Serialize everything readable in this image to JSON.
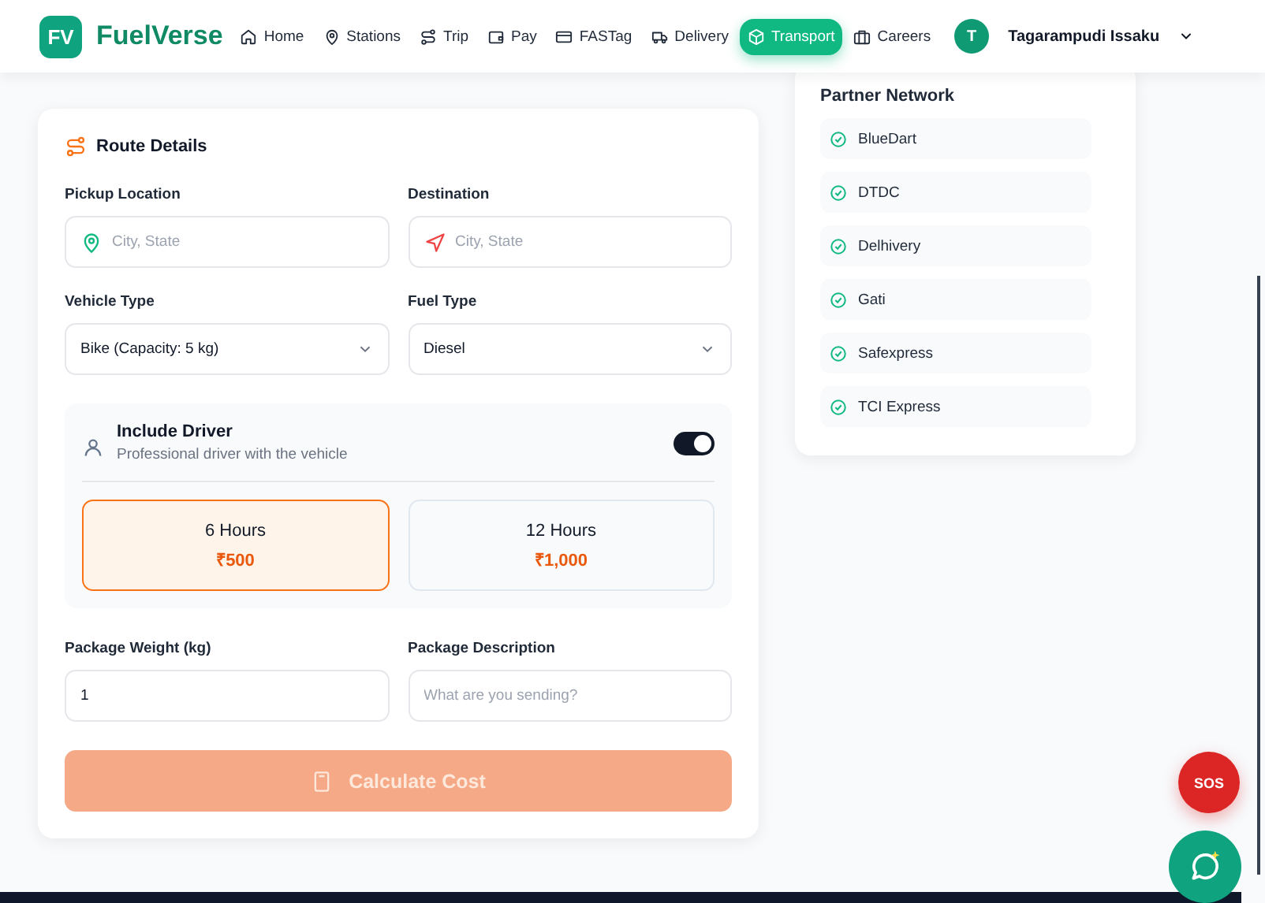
{
  "header": {
    "logo_mark": "FV",
    "brand": "FuelVerse",
    "nav": [
      {
        "label": "Home",
        "selected": false
      },
      {
        "label": "Stations",
        "selected": false
      },
      {
        "label": "Trip",
        "selected": false
      },
      {
        "label": "Pay",
        "selected": false
      },
      {
        "label": "FASTag",
        "selected": false
      },
      {
        "label": "Delivery",
        "selected": false
      },
      {
        "label": "Transport",
        "selected": true
      },
      {
        "label": "Careers",
        "selected": false
      }
    ],
    "user": {
      "initial": "T",
      "name": "Tagarampudi Issaku"
    }
  },
  "route_card": {
    "title": "Route Details",
    "fields": [
      {
        "label": "Pickup Location",
        "kind": "text",
        "placeholder": "City, State"
      },
      {
        "label": "Destination",
        "kind": "text",
        "placeholder": "City, State"
      },
      {
        "label": "Vehicle Type",
        "kind": "select",
        "value": "Bike (Capacity: 5 kg)"
      },
      {
        "label": "Fuel Type",
        "kind": "select",
        "value": "Diesel"
      }
    ],
    "driver": {
      "title": "Include Driver",
      "subtitle": "Professional driver with the vehicle",
      "on": true,
      "options": [
        {
          "label": "6 Hours",
          "price": "₹500",
          "selected": true
        },
        {
          "label": "12 Hours",
          "price": "₹1,000",
          "selected": false
        }
      ]
    },
    "package_fields": [
      {
        "label": "Package Weight (kg)",
        "value": "1"
      },
      {
        "label": "Package Description",
        "placeholder": "What are you sending?"
      }
    ],
    "submit": {
      "label": "Calculate Cost",
      "disabled": true
    }
  },
  "partners": {
    "title": "Partner Network",
    "items": [
      "BlueDart",
      "DTDC",
      "Delhivery",
      "Gati",
      "Safexpress",
      "TCI Express"
    ]
  },
  "sos": "SOS"
}
